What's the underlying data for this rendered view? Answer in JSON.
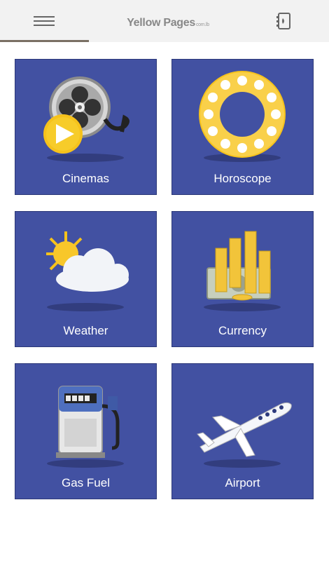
{
  "header": {
    "brand_main": "Yellow Pages",
    "brand_suffix": "com.lb",
    "progress_fraction": 0.27,
    "menu_icon": "hamburger-icon",
    "book_icon": "phonebook-icon"
  },
  "colors": {
    "tile_bg": "#4251a2",
    "header_bg": "#f2f2f2",
    "accent_yellow": "#f6c21b"
  },
  "tiles": [
    {
      "label": "Cinemas",
      "icon": "film-reel-icon"
    },
    {
      "label": "Horoscope",
      "icon": "zodiac-wheel-icon"
    },
    {
      "label": "Weather",
      "icon": "sun-cloud-icon"
    },
    {
      "label": "Currency",
      "icon": "coins-money-icon"
    },
    {
      "label": "Gas Fuel",
      "icon": "fuel-pump-icon"
    },
    {
      "label": "Airport",
      "icon": "airplane-icon"
    }
  ]
}
